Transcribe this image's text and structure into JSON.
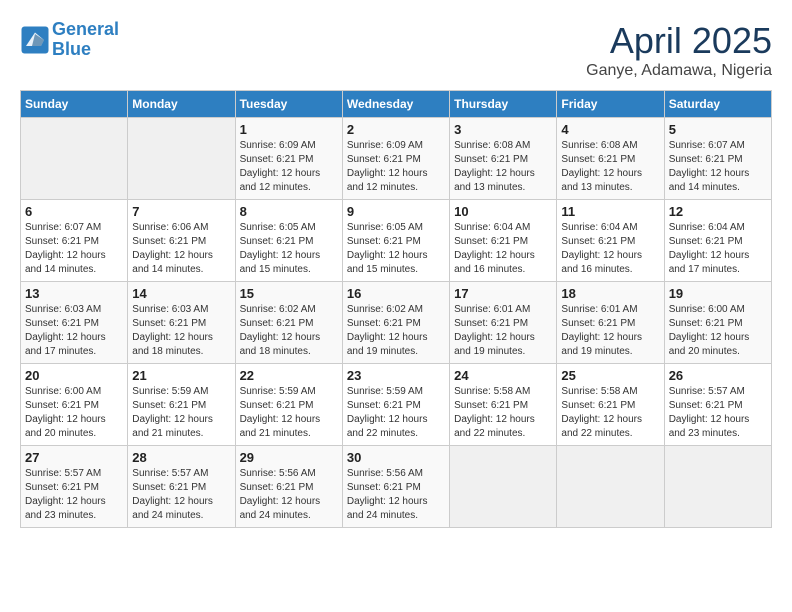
{
  "header": {
    "logo_line1": "General",
    "logo_line2": "Blue",
    "month": "April 2025",
    "location": "Ganye, Adamawa, Nigeria"
  },
  "days_of_week": [
    "Sunday",
    "Monday",
    "Tuesday",
    "Wednesday",
    "Thursday",
    "Friday",
    "Saturday"
  ],
  "weeks": [
    [
      {
        "num": "",
        "info": ""
      },
      {
        "num": "",
        "info": ""
      },
      {
        "num": "1",
        "info": "Sunrise: 6:09 AM\nSunset: 6:21 PM\nDaylight: 12 hours and 12 minutes."
      },
      {
        "num": "2",
        "info": "Sunrise: 6:09 AM\nSunset: 6:21 PM\nDaylight: 12 hours and 12 minutes."
      },
      {
        "num": "3",
        "info": "Sunrise: 6:08 AM\nSunset: 6:21 PM\nDaylight: 12 hours and 13 minutes."
      },
      {
        "num": "4",
        "info": "Sunrise: 6:08 AM\nSunset: 6:21 PM\nDaylight: 12 hours and 13 minutes."
      },
      {
        "num": "5",
        "info": "Sunrise: 6:07 AM\nSunset: 6:21 PM\nDaylight: 12 hours and 14 minutes."
      }
    ],
    [
      {
        "num": "6",
        "info": "Sunrise: 6:07 AM\nSunset: 6:21 PM\nDaylight: 12 hours and 14 minutes."
      },
      {
        "num": "7",
        "info": "Sunrise: 6:06 AM\nSunset: 6:21 PM\nDaylight: 12 hours and 14 minutes."
      },
      {
        "num": "8",
        "info": "Sunrise: 6:05 AM\nSunset: 6:21 PM\nDaylight: 12 hours and 15 minutes."
      },
      {
        "num": "9",
        "info": "Sunrise: 6:05 AM\nSunset: 6:21 PM\nDaylight: 12 hours and 15 minutes."
      },
      {
        "num": "10",
        "info": "Sunrise: 6:04 AM\nSunset: 6:21 PM\nDaylight: 12 hours and 16 minutes."
      },
      {
        "num": "11",
        "info": "Sunrise: 6:04 AM\nSunset: 6:21 PM\nDaylight: 12 hours and 16 minutes."
      },
      {
        "num": "12",
        "info": "Sunrise: 6:04 AM\nSunset: 6:21 PM\nDaylight: 12 hours and 17 minutes."
      }
    ],
    [
      {
        "num": "13",
        "info": "Sunrise: 6:03 AM\nSunset: 6:21 PM\nDaylight: 12 hours and 17 minutes."
      },
      {
        "num": "14",
        "info": "Sunrise: 6:03 AM\nSunset: 6:21 PM\nDaylight: 12 hours and 18 minutes."
      },
      {
        "num": "15",
        "info": "Sunrise: 6:02 AM\nSunset: 6:21 PM\nDaylight: 12 hours and 18 minutes."
      },
      {
        "num": "16",
        "info": "Sunrise: 6:02 AM\nSunset: 6:21 PM\nDaylight: 12 hours and 19 minutes."
      },
      {
        "num": "17",
        "info": "Sunrise: 6:01 AM\nSunset: 6:21 PM\nDaylight: 12 hours and 19 minutes."
      },
      {
        "num": "18",
        "info": "Sunrise: 6:01 AM\nSunset: 6:21 PM\nDaylight: 12 hours and 19 minutes."
      },
      {
        "num": "19",
        "info": "Sunrise: 6:00 AM\nSunset: 6:21 PM\nDaylight: 12 hours and 20 minutes."
      }
    ],
    [
      {
        "num": "20",
        "info": "Sunrise: 6:00 AM\nSunset: 6:21 PM\nDaylight: 12 hours and 20 minutes."
      },
      {
        "num": "21",
        "info": "Sunrise: 5:59 AM\nSunset: 6:21 PM\nDaylight: 12 hours and 21 minutes."
      },
      {
        "num": "22",
        "info": "Sunrise: 5:59 AM\nSunset: 6:21 PM\nDaylight: 12 hours and 21 minutes."
      },
      {
        "num": "23",
        "info": "Sunrise: 5:59 AM\nSunset: 6:21 PM\nDaylight: 12 hours and 22 minutes."
      },
      {
        "num": "24",
        "info": "Sunrise: 5:58 AM\nSunset: 6:21 PM\nDaylight: 12 hours and 22 minutes."
      },
      {
        "num": "25",
        "info": "Sunrise: 5:58 AM\nSunset: 6:21 PM\nDaylight: 12 hours and 22 minutes."
      },
      {
        "num": "26",
        "info": "Sunrise: 5:57 AM\nSunset: 6:21 PM\nDaylight: 12 hours and 23 minutes."
      }
    ],
    [
      {
        "num": "27",
        "info": "Sunrise: 5:57 AM\nSunset: 6:21 PM\nDaylight: 12 hours and 23 minutes."
      },
      {
        "num": "28",
        "info": "Sunrise: 5:57 AM\nSunset: 6:21 PM\nDaylight: 12 hours and 24 minutes."
      },
      {
        "num": "29",
        "info": "Sunrise: 5:56 AM\nSunset: 6:21 PM\nDaylight: 12 hours and 24 minutes."
      },
      {
        "num": "30",
        "info": "Sunrise: 5:56 AM\nSunset: 6:21 PM\nDaylight: 12 hours and 24 minutes."
      },
      {
        "num": "",
        "info": ""
      },
      {
        "num": "",
        "info": ""
      },
      {
        "num": "",
        "info": ""
      }
    ]
  ]
}
